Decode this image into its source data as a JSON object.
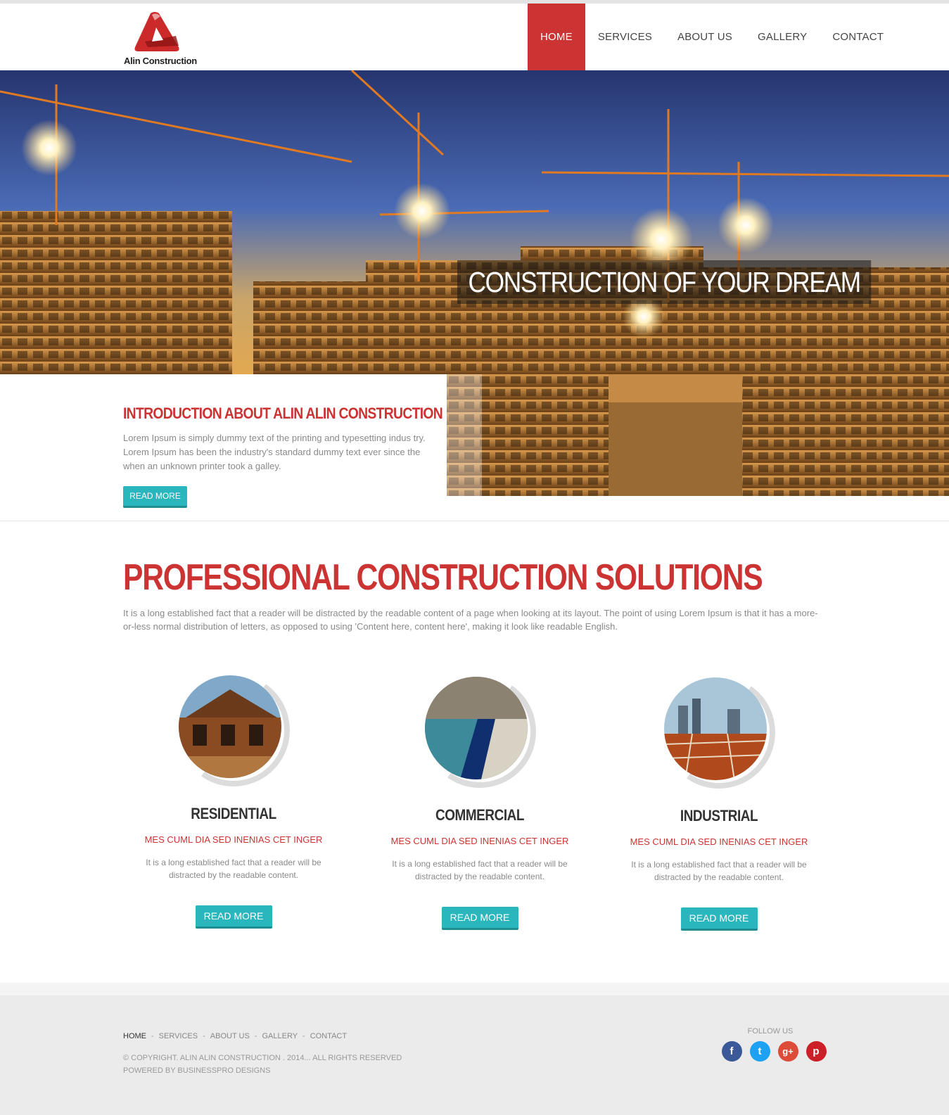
{
  "brand": {
    "name": "Alin Construction",
    "accent": "#cc3333",
    "teal": "#2ab6bd"
  },
  "nav": {
    "items": [
      {
        "label": "HOME",
        "active": true
      },
      {
        "label": "SERVICES",
        "active": false
      },
      {
        "label": "ABOUT US",
        "active": false
      },
      {
        "label": "GALLERY",
        "active": false
      },
      {
        "label": "CONTACT",
        "active": false
      }
    ]
  },
  "hero": {
    "caption": "CONSTRUCTION OF YOUR DREAM"
  },
  "intro": {
    "title": "INTRODUCTION ABOUT ALIN ALIN CONSTRUCTION",
    "text": "Lorem Ipsum is simply dummy text of the printing and typesetting indus try. Lorem Ipsum has been the industry's standard dummy text ever since the when an unknown printer took a galley.",
    "button": "READ MORE"
  },
  "solutions": {
    "title": "PROFESSIONAL CONSTRUCTION SOLUTIONS",
    "text": "It is a long established fact that a reader will be distracted by the readable content of a page when looking at its layout. The point of using Lorem Ipsum is that it has a more-or-less normal distribution of letters, as opposed to using 'Content here, content here', making it look like readable English."
  },
  "services": [
    {
      "title": "RESIDENTIAL",
      "subtitle": "MES CUML DIA SED INENIAS CET INGER",
      "text": "It is a long established fact that a reader will be distracted by the readable content.",
      "button": "READ MORE"
    },
    {
      "title": "COMMERCIAL",
      "subtitle": "MES CUML DIA SED INENIAS CET INGER",
      "text": "It is a long established fact that a reader will be distracted by the readable content.",
      "button": "READ MORE"
    },
    {
      "title": "INDUSTRIAL",
      "subtitle": "MES CUML DIA SED INENIAS CET INGER",
      "text": "It is a long established fact that a reader will be distracted by the readable content.",
      "button": "READ MORE"
    }
  ],
  "footer": {
    "links": [
      "HOME",
      "SERVICES",
      "ABOUT US",
      "GALLERY",
      "CONTACT"
    ],
    "separator": "-",
    "copyright": "© COPYRIGHT. ALIN ALIN CONSTRUCTION . 2014... ALL RIGHTS RESERVED",
    "powered": "POWERED BY BUSINESSPRO DESIGNS",
    "follow_label": "FOLLOW US",
    "social": [
      {
        "icon": "facebook-icon",
        "glyph": "f",
        "color": "#3b5998"
      },
      {
        "icon": "twitter-icon",
        "glyph": "t",
        "color": "#1da1f2"
      },
      {
        "icon": "google-plus-icon",
        "glyph": "g+",
        "color": "#dd4b39"
      },
      {
        "icon": "pinterest-icon",
        "glyph": "p",
        "color": "#cb2027"
      }
    ]
  }
}
